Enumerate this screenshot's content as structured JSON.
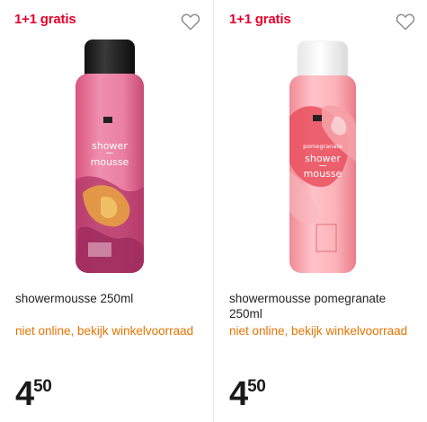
{
  "products": [
    {
      "promo": "1+1 gratis",
      "name": "showermousse 250ml",
      "availability": "niet online, bekijk winkelvoorraad",
      "price_euros": "4",
      "price_cents": "50",
      "can_label": [
        "shower",
        "mousse"
      ],
      "icons": {
        "favorite": "heart-outline-icon"
      }
    },
    {
      "promo": "1+1 gratis",
      "name": "showermousse pomegranate 250ml",
      "availability": "niet online, bekijk winkelvoorraad",
      "price_euros": "4",
      "price_cents": "50",
      "can_label": [
        "pomegranate",
        "shower",
        "mousse"
      ],
      "icons": {
        "favorite": "heart-outline-icon"
      }
    }
  ],
  "colors": {
    "promo": "#e4002b",
    "availability": "#e67300",
    "text": "#222222"
  }
}
